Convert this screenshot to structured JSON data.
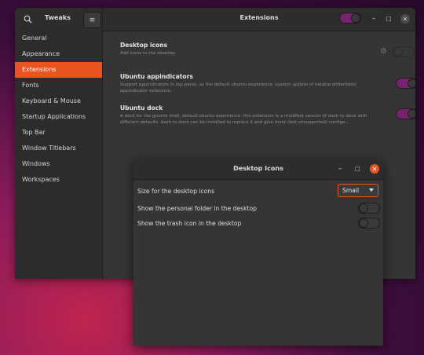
{
  "main_window": {
    "app_title": "Tweaks",
    "page_title": "Extensions",
    "global_switch": "on",
    "sidebar": {
      "items": [
        {
          "label": "General",
          "active": false
        },
        {
          "label": "Appearance",
          "active": false
        },
        {
          "label": "Extensions",
          "active": true
        },
        {
          "label": "Fonts",
          "active": false
        },
        {
          "label": "Keyboard & Mouse",
          "active": false
        },
        {
          "label": "Startup Applications",
          "active": false
        },
        {
          "label": "Top Bar",
          "active": false
        },
        {
          "label": "Window Titlebars",
          "active": false
        },
        {
          "label": "Windows",
          "active": false
        },
        {
          "label": "Workspaces",
          "active": false
        }
      ]
    },
    "extensions": [
      {
        "name": "Desktop icons",
        "desc": "Add icons to the desktop.",
        "state": "off"
      },
      {
        "name": "Ubuntu appindicators",
        "desc": "Support appindicators in top panel, as the default ubuntu experience. system update of katatunotifierItem/ appindicator extension.",
        "state": "on"
      },
      {
        "name": "Ubuntu dock",
        "desc": "A dock for the gnome shell, default ubuntu experience. this extension is a modified version of dash to dock with different defaults. dash to dock can be installed to replace it and give more (but unsupported) configo...",
        "state": "on"
      }
    ]
  },
  "dialog": {
    "title": "Desktop Icons",
    "size_label": "Size for the desktop icons",
    "size_value": "Small",
    "personal_folder_label": "Show the personal folder in the desktop",
    "personal_folder_state": "off",
    "trash_label": "Show the trash icon in the desktop",
    "trash_state": "off"
  },
  "icons": {
    "search": "search-icon",
    "menu": "hamburger-menu-icon",
    "minimize": "minimize-icon",
    "maximize": "maximize-icon",
    "close": "close-icon",
    "gear": "gear-icon"
  },
  "colors": {
    "accent": "#e95420",
    "switch_on": "#77216f",
    "window_bg": "#353535",
    "sidebar_bg": "#2c2c2c"
  }
}
